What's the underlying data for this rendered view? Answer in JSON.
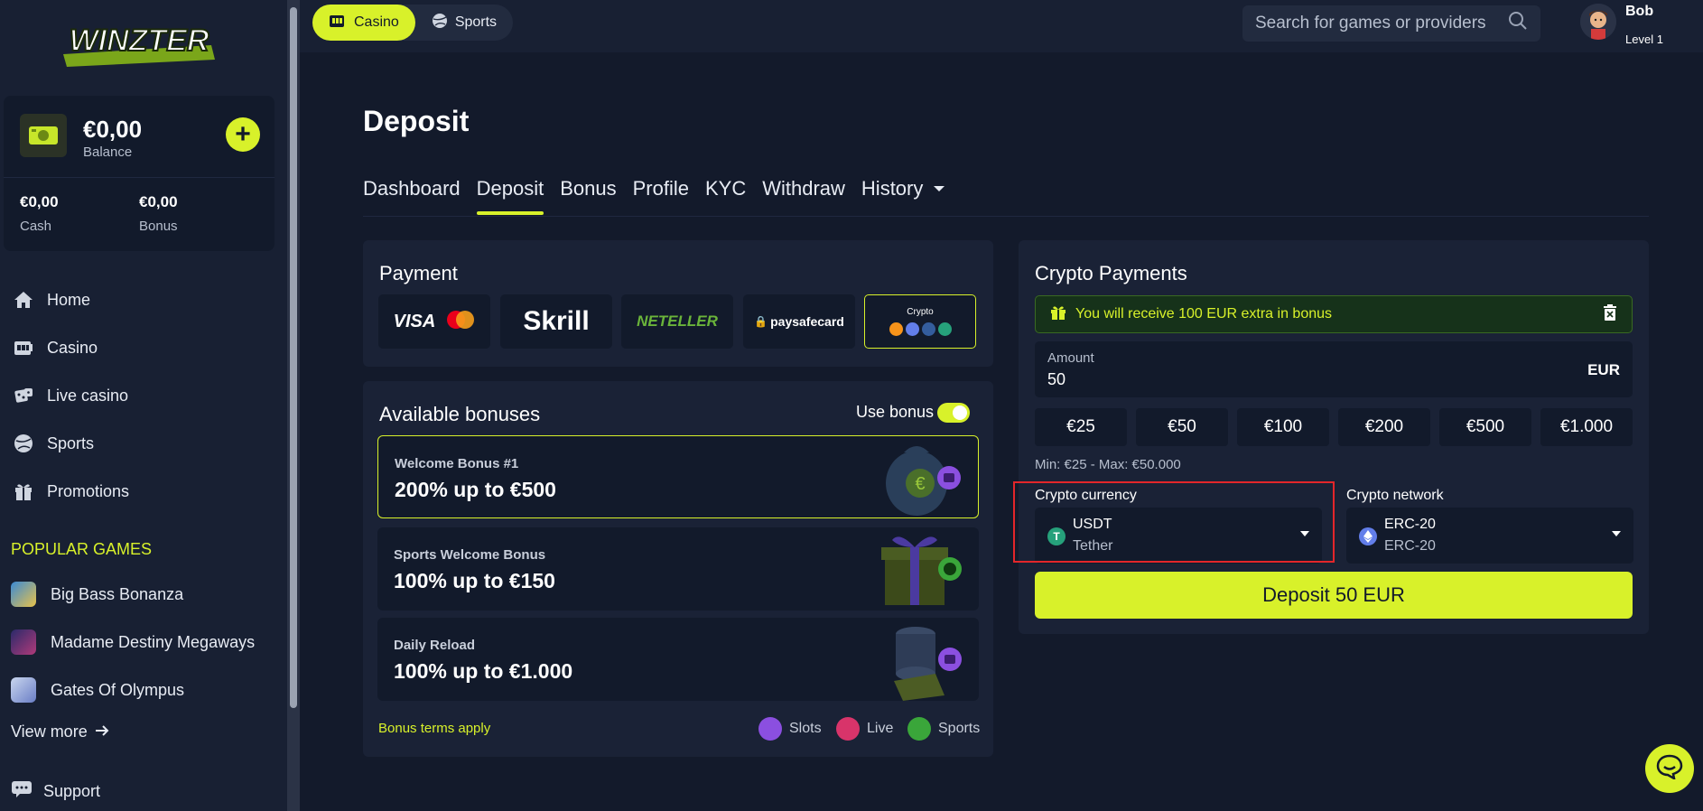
{
  "brand": {
    "logo_text": "WINZTER",
    "accent": "#d8f12a"
  },
  "balance": {
    "amount": "€0,00",
    "label": "Balance",
    "cash_amount": "€0,00",
    "cash_label": "Cash",
    "bonus_amount": "€0,00",
    "bonus_label": "Bonus",
    "add_icon": "plus-icon"
  },
  "nav": [
    {
      "label": "Home",
      "icon": "home-icon"
    },
    {
      "label": "Casino",
      "icon": "slot-machine-icon"
    },
    {
      "label": "Live casino",
      "icon": "dice-icon"
    },
    {
      "label": "Sports",
      "icon": "ball-icon"
    },
    {
      "label": "Promotions",
      "icon": "gift-icon"
    }
  ],
  "popular": {
    "title": "POPULAR GAMES",
    "games": [
      "Big Bass Bonanza",
      "Madame Destiny Megaways",
      "Gates Of Olympus"
    ],
    "view_more": "View more"
  },
  "support": "Support",
  "topbar": {
    "pills": [
      {
        "label": "Casino",
        "active": true
      },
      {
        "label": "Sports",
        "active": false
      }
    ],
    "search_placeholder": "Search for games or providers",
    "user_name": "Bob",
    "user_level": "Level 1"
  },
  "page": {
    "title": "Deposit",
    "tabs": [
      "Dashboard",
      "Deposit",
      "Bonus",
      "Profile",
      "KYC",
      "Withdraw",
      "History"
    ],
    "active_tab": "Deposit"
  },
  "payment": {
    "title": "Payment",
    "methods": [
      "VISA",
      "Skrill",
      "NETELLER",
      "paysafecard",
      "Crypto"
    ]
  },
  "bonuses": {
    "title": "Available bonuses",
    "use_bonus_label": "Use bonus",
    "use_bonus_on": true,
    "items": [
      {
        "name": "Welcome Bonus #1",
        "offer": "200% up to €500",
        "type": "slots"
      },
      {
        "name": "Sports Welcome Bonus",
        "offer": "100% up to €150",
        "type": "sports"
      },
      {
        "name": "Daily Reload",
        "offer": "100% up to €1.000",
        "type": "slots"
      }
    ],
    "terms": "Bonus terms apply",
    "legend": [
      "Slots",
      "Live",
      "Sports"
    ]
  },
  "crypto": {
    "title": "Crypto Payments",
    "banner": "You will receive 100 EUR extra in bonus",
    "amount_label": "Amount",
    "amount_value": "50",
    "amount_currency": "EUR",
    "quick_amounts": [
      "€25",
      "€50",
      "€100",
      "€200",
      "€500",
      "€1.000"
    ],
    "limits": "Min: €25 - Max: €50.000",
    "currency_label": "Crypto currency",
    "currency_main": "USDT",
    "currency_sub": "Tether",
    "network_label": "Crypto network",
    "network_main": "ERC-20",
    "network_sub": "ERC-20",
    "deposit_button": "Deposit 50 EUR"
  }
}
